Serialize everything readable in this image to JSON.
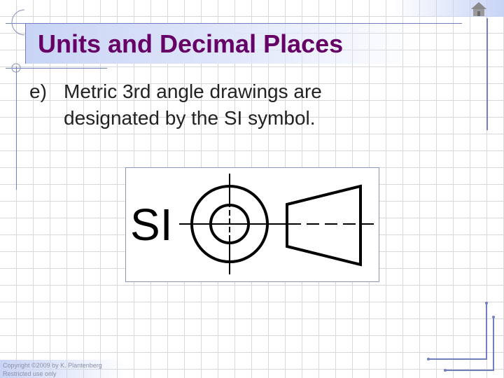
{
  "slide": {
    "title": "Units and Decimal Places",
    "bullet_label": "e)",
    "bullet_line1": "Metric 3rd angle drawings are",
    "bullet_line2": "designated by the SI symbol.",
    "figure_text": "SI",
    "footer_line1": "Copyright ©2009 by K. Plantenberg",
    "footer_line2": "Restricted use only"
  },
  "icons": {
    "home": "home-icon"
  },
  "colors": {
    "title": "#660066",
    "accent": "#6f7fc0",
    "band": "#c8d4f5"
  }
}
